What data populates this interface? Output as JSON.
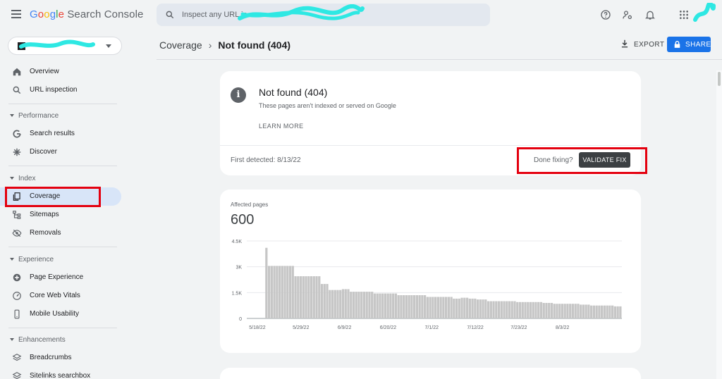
{
  "app": {
    "logo_parts": [
      "G",
      "o",
      "o",
      "g",
      "l",
      "e"
    ],
    "product_name": "Search Console"
  },
  "search": {
    "placeholder": "Inspect any URL in"
  },
  "sidebar": {
    "overview": "Overview",
    "url_inspection": "URL inspection",
    "section_performance": "Performance",
    "search_results": "Search results",
    "discover": "Discover",
    "section_index": "Index",
    "coverage": "Coverage",
    "sitemaps": "Sitemaps",
    "removals": "Removals",
    "section_experience": "Experience",
    "page_experience": "Page Experience",
    "core_web_vitals": "Core Web Vitals",
    "mobile_usability": "Mobile Usability",
    "section_enhancements": "Enhancements",
    "breadcrumbs": "Breadcrumbs",
    "sitelinks": "Sitelinks searchbox"
  },
  "header": {
    "breadcrumb_parent": "Coverage",
    "breadcrumb_sep": "›",
    "breadcrumb_current": "Not found (404)",
    "export_label": "EXPORT",
    "share_label": "SHARE"
  },
  "issue_card": {
    "title": "Not found (404)",
    "subtitle": "These pages aren't indexed or served on Google",
    "learn_more": "LEARN MORE",
    "first_detected": "First detected: 8/13/22",
    "done_fixing": "Done fixing?",
    "validate_fix": "VALIDATE FIX"
  },
  "affected": {
    "label": "Affected pages",
    "value": "600"
  },
  "colors": {
    "accent": "#1a73e8",
    "highlight_box": "#e4000f",
    "bar": "#c6c6c6",
    "active_nav": "#d8e5f8"
  },
  "chart_data": {
    "type": "bar",
    "x_tick_labels": [
      "5/18/22",
      "5/29/22",
      "6/9/22",
      "6/20/22",
      "7/1/22",
      "7/12/22",
      "7/23/22",
      "8/3/22"
    ],
    "y_tick_labels": [
      "0",
      "1.5K",
      "3K",
      "4.5K"
    ],
    "ylim": [
      0,
      4500
    ],
    "grid": true,
    "x_start": "5/18/22",
    "values": [
      0,
      0,
      0,
      0,
      0,
      0,
      0,
      4100,
      3050,
      3050,
      3050,
      3050,
      3050,
      3050,
      3050,
      3050,
      3050,
      3050,
      2450,
      2450,
      2450,
      2450,
      2450,
      2450,
      2450,
      2450,
      2450,
      2450,
      2000,
      2000,
      2000,
      1650,
      1650,
      1650,
      1650,
      1650,
      1700,
      1700,
      1700,
      1550,
      1550,
      1550,
      1550,
      1550,
      1550,
      1550,
      1550,
      1550,
      1450,
      1450,
      1450,
      1450,
      1450,
      1450,
      1450,
      1450,
      1450,
      1350,
      1350,
      1350,
      1350,
      1350,
      1350,
      1350,
      1350,
      1350,
      1350,
      1350,
      1250,
      1250,
      1250,
      1250,
      1250,
      1250,
      1250,
      1250,
      1250,
      1250,
      1150,
      1150,
      1150,
      1200,
      1200,
      1200,
      1150,
      1150,
      1150,
      1100,
      1100,
      1100,
      1100,
      1000,
      1000,
      1000,
      1000,
      1000,
      1000,
      1000,
      1000,
      1000,
      1000,
      1000,
      950,
      950,
      950,
      950,
      950,
      950,
      950,
      950,
      950,
      950,
      900,
      900,
      900,
      900,
      850,
      850,
      850,
      850,
      850,
      850,
      850,
      850,
      850,
      850,
      800,
      800,
      800,
      800,
      750,
      750,
      750,
      750,
      750,
      750,
      750,
      750,
      750,
      700,
      700,
      700
    ]
  }
}
